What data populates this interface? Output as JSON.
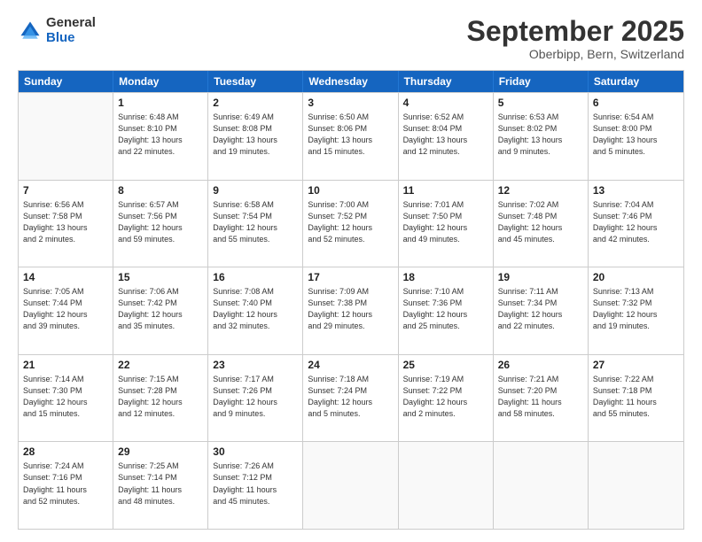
{
  "header": {
    "logo_general": "General",
    "logo_blue": "Blue",
    "month_title": "September 2025",
    "location": "Oberbipp, Bern, Switzerland"
  },
  "days_of_week": [
    "Sunday",
    "Monday",
    "Tuesday",
    "Wednesday",
    "Thursday",
    "Friday",
    "Saturday"
  ],
  "weeks": [
    [
      {
        "day": "",
        "info": ""
      },
      {
        "day": "1",
        "info": "Sunrise: 6:48 AM\nSunset: 8:10 PM\nDaylight: 13 hours\nand 22 minutes."
      },
      {
        "day": "2",
        "info": "Sunrise: 6:49 AM\nSunset: 8:08 PM\nDaylight: 13 hours\nand 19 minutes."
      },
      {
        "day": "3",
        "info": "Sunrise: 6:50 AM\nSunset: 8:06 PM\nDaylight: 13 hours\nand 15 minutes."
      },
      {
        "day": "4",
        "info": "Sunrise: 6:52 AM\nSunset: 8:04 PM\nDaylight: 13 hours\nand 12 minutes."
      },
      {
        "day": "5",
        "info": "Sunrise: 6:53 AM\nSunset: 8:02 PM\nDaylight: 13 hours\nand 9 minutes."
      },
      {
        "day": "6",
        "info": "Sunrise: 6:54 AM\nSunset: 8:00 PM\nDaylight: 13 hours\nand 5 minutes."
      }
    ],
    [
      {
        "day": "7",
        "info": "Sunrise: 6:56 AM\nSunset: 7:58 PM\nDaylight: 13 hours\nand 2 minutes."
      },
      {
        "day": "8",
        "info": "Sunrise: 6:57 AM\nSunset: 7:56 PM\nDaylight: 12 hours\nand 59 minutes."
      },
      {
        "day": "9",
        "info": "Sunrise: 6:58 AM\nSunset: 7:54 PM\nDaylight: 12 hours\nand 55 minutes."
      },
      {
        "day": "10",
        "info": "Sunrise: 7:00 AM\nSunset: 7:52 PM\nDaylight: 12 hours\nand 52 minutes."
      },
      {
        "day": "11",
        "info": "Sunrise: 7:01 AM\nSunset: 7:50 PM\nDaylight: 12 hours\nand 49 minutes."
      },
      {
        "day": "12",
        "info": "Sunrise: 7:02 AM\nSunset: 7:48 PM\nDaylight: 12 hours\nand 45 minutes."
      },
      {
        "day": "13",
        "info": "Sunrise: 7:04 AM\nSunset: 7:46 PM\nDaylight: 12 hours\nand 42 minutes."
      }
    ],
    [
      {
        "day": "14",
        "info": "Sunrise: 7:05 AM\nSunset: 7:44 PM\nDaylight: 12 hours\nand 39 minutes."
      },
      {
        "day": "15",
        "info": "Sunrise: 7:06 AM\nSunset: 7:42 PM\nDaylight: 12 hours\nand 35 minutes."
      },
      {
        "day": "16",
        "info": "Sunrise: 7:08 AM\nSunset: 7:40 PM\nDaylight: 12 hours\nand 32 minutes."
      },
      {
        "day": "17",
        "info": "Sunrise: 7:09 AM\nSunset: 7:38 PM\nDaylight: 12 hours\nand 29 minutes."
      },
      {
        "day": "18",
        "info": "Sunrise: 7:10 AM\nSunset: 7:36 PM\nDaylight: 12 hours\nand 25 minutes."
      },
      {
        "day": "19",
        "info": "Sunrise: 7:11 AM\nSunset: 7:34 PM\nDaylight: 12 hours\nand 22 minutes."
      },
      {
        "day": "20",
        "info": "Sunrise: 7:13 AM\nSunset: 7:32 PM\nDaylight: 12 hours\nand 19 minutes."
      }
    ],
    [
      {
        "day": "21",
        "info": "Sunrise: 7:14 AM\nSunset: 7:30 PM\nDaylight: 12 hours\nand 15 minutes."
      },
      {
        "day": "22",
        "info": "Sunrise: 7:15 AM\nSunset: 7:28 PM\nDaylight: 12 hours\nand 12 minutes."
      },
      {
        "day": "23",
        "info": "Sunrise: 7:17 AM\nSunset: 7:26 PM\nDaylight: 12 hours\nand 9 minutes."
      },
      {
        "day": "24",
        "info": "Sunrise: 7:18 AM\nSunset: 7:24 PM\nDaylight: 12 hours\nand 5 minutes."
      },
      {
        "day": "25",
        "info": "Sunrise: 7:19 AM\nSunset: 7:22 PM\nDaylight: 12 hours\nand 2 minutes."
      },
      {
        "day": "26",
        "info": "Sunrise: 7:21 AM\nSunset: 7:20 PM\nDaylight: 11 hours\nand 58 minutes."
      },
      {
        "day": "27",
        "info": "Sunrise: 7:22 AM\nSunset: 7:18 PM\nDaylight: 11 hours\nand 55 minutes."
      }
    ],
    [
      {
        "day": "28",
        "info": "Sunrise: 7:24 AM\nSunset: 7:16 PM\nDaylight: 11 hours\nand 52 minutes."
      },
      {
        "day": "29",
        "info": "Sunrise: 7:25 AM\nSunset: 7:14 PM\nDaylight: 11 hours\nand 48 minutes."
      },
      {
        "day": "30",
        "info": "Sunrise: 7:26 AM\nSunset: 7:12 PM\nDaylight: 11 hours\nand 45 minutes."
      },
      {
        "day": "",
        "info": ""
      },
      {
        "day": "",
        "info": ""
      },
      {
        "day": "",
        "info": ""
      },
      {
        "day": "",
        "info": ""
      }
    ]
  ]
}
